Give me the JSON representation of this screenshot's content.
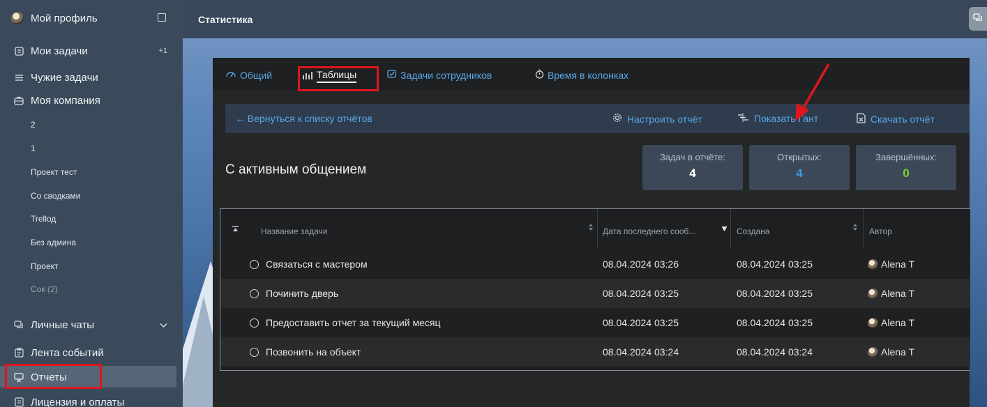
{
  "sidebar": {
    "profile_label": "Мой профиль",
    "my_tasks": {
      "label": "Мои задачи",
      "badge": "+1"
    },
    "others_tasks": "Чужие задачи",
    "my_company": "Моя компания",
    "projects": [
      "2",
      "1",
      "Проект тест",
      "Со сводками",
      "Trellод",
      "Без админа",
      "Проект",
      "Сок (2)"
    ],
    "personal_chats": "Личные чаты",
    "event_feed": "Лента событий",
    "reports": "Отчеты",
    "license": "Лицензия и оплаты"
  },
  "header": {
    "title": "Статистика"
  },
  "tabs": [
    {
      "label": "Общий",
      "icon": "gauge-icon"
    },
    {
      "label": "Таблицы",
      "icon": "bar-chart-icon"
    },
    {
      "label": "Задачи сотрудников",
      "icon": "checkbox-icon"
    },
    {
      "label": "Время в колонках",
      "icon": "stopwatch-icon"
    }
  ],
  "toolbar": {
    "back": "← Вернуться к списку отчётов",
    "configure": "Настроить отчёт",
    "gantt": "Показать Гант",
    "download": "Скачать отчёт"
  },
  "report": {
    "title": "С активным общением",
    "stats": [
      {
        "label": "Задач в отчёте:",
        "value": "4",
        "color": "#ffffff"
      },
      {
        "label": "Открытых:",
        "value": "4",
        "color": "#3b9ae1"
      },
      {
        "label": "Завершённых:",
        "value": "0",
        "color": "#7ed321"
      }
    ]
  },
  "table": {
    "columns": [
      "Название задачи",
      "Дата последнего сооб...",
      "Создана",
      "Автор"
    ],
    "rows": [
      {
        "name": "Связаться с мастером",
        "last_msg": "08.04.2024 03:26",
        "created": "08.04.2024 03:25",
        "author": "Alena T"
      },
      {
        "name": "Починить дверь",
        "last_msg": "08.04.2024 03:25",
        "created": "08.04.2024 03:25",
        "author": "Alena T"
      },
      {
        "name": "Предоставить отчет за текущий месяц",
        "last_msg": "08.04.2024 03:25",
        "created": "08.04.2024 03:25",
        "author": "Alena T"
      },
      {
        "name": "Позвонить на объект",
        "last_msg": "08.04.2024 03:24",
        "created": "08.04.2024 03:24",
        "author": "Alena T"
      }
    ]
  }
}
